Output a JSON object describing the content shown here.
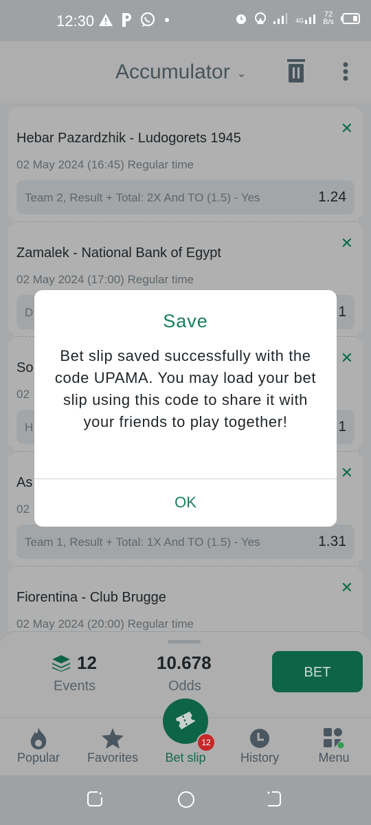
{
  "status_bar": {
    "time": "12:30",
    "left_icons": [
      "warning-icon",
      "p-icon",
      "whatsapp-icon",
      "dot-icon"
    ],
    "right_icons": [
      "alarm-icon",
      "hotspot-icon",
      "signal-icon",
      "4g-signal-icon",
      "battery-icon"
    ],
    "network_type": "4G",
    "speed_value": "72",
    "speed_unit": "B/s"
  },
  "header": {
    "title": "Accumulator",
    "dropdown_icon": "chevron-down-icon",
    "actions": [
      "trash-icon",
      "more-vertical-icon"
    ]
  },
  "events": [
    {
      "teams": "Hebar Pazardzhik - Ludogorets 1945",
      "date": "02 May 2024 (16:45) Regular time",
      "pick": "Team 2, Result + Total: 2X And TO (1.5) - Yes",
      "odds": "1.24"
    },
    {
      "teams": "Zamalek - National Bank of Egypt",
      "date": "02 May 2024 (17:00) Regular time",
      "pick": "D",
      "odds": "1"
    },
    {
      "teams": "So",
      "date": "02",
      "pick": "H",
      "odds": "1"
    },
    {
      "teams": "As",
      "date": "02",
      "pick": "Team 1, Result + Total: 1X And TO (1.5) - Yes",
      "odds": "1.31"
    },
    {
      "teams": "Fiorentina - Club Brugge",
      "date": "02 May 2024 (20:00) Regular time",
      "pick": "",
      "odds": ""
    }
  ],
  "dialog": {
    "title": "Save",
    "message": "Bet slip saved successfully with the code UPAMA. You may load your bet slip using this code to share it with your friends to play together!",
    "ok_label": "OK"
  },
  "summary": {
    "events_count": "12",
    "events_label": "Events",
    "odds_value": "10.678",
    "odds_label": "Odds",
    "bet_label": "BET"
  },
  "bottom_nav": {
    "items": [
      {
        "label": "Popular",
        "icon": "fire-icon"
      },
      {
        "label": "Favorites",
        "icon": "star-icon"
      },
      {
        "label": "Bet slip",
        "icon": "ticket-icon",
        "badge": "12",
        "active": true
      },
      {
        "label": "History",
        "icon": "clock-icon"
      },
      {
        "label": "Menu",
        "icon": "menu-grid-icon"
      }
    ]
  },
  "colors": {
    "brand_green": "#0e6447",
    "accent_green": "#17805a",
    "badge_red": "#c62828"
  }
}
